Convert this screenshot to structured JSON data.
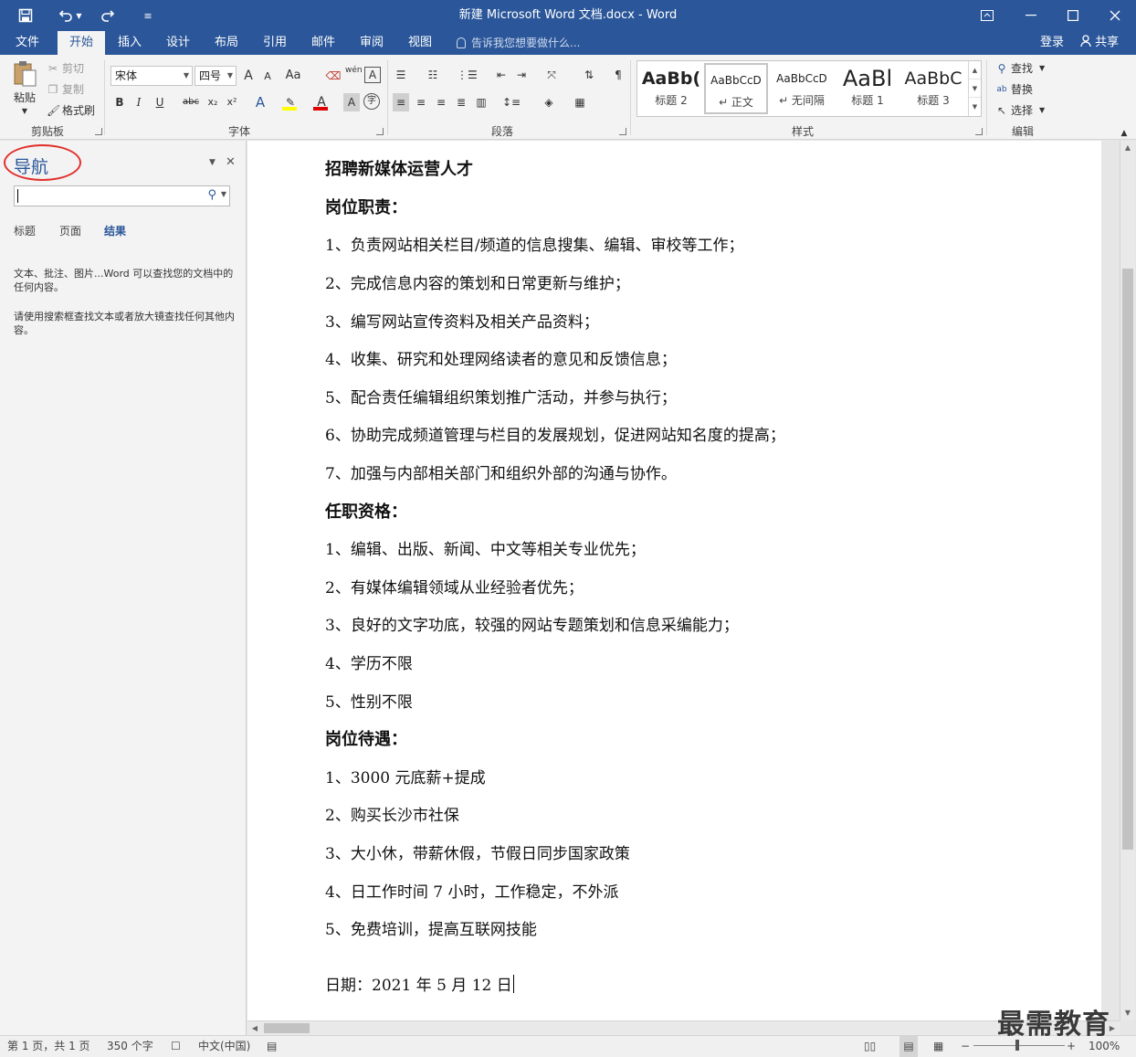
{
  "window": {
    "title": "新建 Microsoft Word 文档.docx - Word",
    "qa_customize_glyph": "≡"
  },
  "tabs": [
    {
      "label": "文件"
    },
    {
      "label": "开始"
    },
    {
      "label": "插入"
    },
    {
      "label": "设计"
    },
    {
      "label": "布局"
    },
    {
      "label": "引用"
    },
    {
      "label": "邮件"
    },
    {
      "label": "审阅"
    },
    {
      "label": "视图"
    }
  ],
  "tell_me": "告诉我您想要做什么...",
  "account": {
    "login": "登录",
    "share": "共享"
  },
  "ribbon": {
    "clipboard": {
      "label": "剪贴板",
      "paste": "粘贴",
      "cut": "剪切",
      "copy": "复制",
      "format_painter": "格式刷"
    },
    "font": {
      "label": "字体",
      "font_name": "宋体",
      "font_size": "四号",
      "grow": "A",
      "shrink": "A",
      "change_case": "Aa",
      "bold": "B",
      "italic": "I",
      "underline": "U",
      "strike": "abc",
      "subscript": "x₂",
      "superscript": "x²",
      "effects": "A",
      "font_color": "A",
      "char_shading": "A",
      "enclose": "字",
      "phonetic": "wén",
      "border_char": "A"
    },
    "paragraph": {
      "label": "段落"
    },
    "styles": {
      "label": "样式",
      "items": [
        {
          "sample": "AaBb(",
          "name": "标题 2"
        },
        {
          "sample": "AaBbCcD",
          "name": "↵ 正文"
        },
        {
          "sample": "AaBbCcD",
          "name": "↵ 无间隔"
        },
        {
          "sample": "AaBl",
          "name": "标题 1"
        },
        {
          "sample": "AaBbC",
          "name": "标题 3"
        }
      ]
    },
    "editing": {
      "label": "编辑",
      "find": "查找",
      "replace": "替换",
      "select": "选择"
    }
  },
  "nav": {
    "title": "导航",
    "search_value": "",
    "tabs": [
      "标题",
      "页面",
      "结果"
    ],
    "msg1": "文本、批注、图片...Word 可以查找您的文档中的任何内容。",
    "msg2": "请使用搜索框查找文本或者放大镜查找任何其他内容。"
  },
  "document": {
    "paragraphs": [
      {
        "text": "招聘新媒体运营人才",
        "heading": true
      },
      {
        "text": "岗位职责：",
        "heading": true
      },
      {
        "text": "1、负责网站相关栏目/频道的信息搜集、编辑、审校等工作；",
        "heading": false
      },
      {
        "text": "2、完成信息内容的策划和日常更新与维护；",
        "heading": false
      },
      {
        "text": "3、编写网站宣传资料及相关产品资料；",
        "heading": false
      },
      {
        "text": "4、收集、研究和处理网络读者的意见和反馈信息；",
        "heading": false
      },
      {
        "text": "5、配合责任编辑组织策划推广活动，并参与执行；",
        "heading": false
      },
      {
        "text": "6、协助完成频道管理与栏目的发展规划，促进网站知名度的提高；",
        "heading": false
      },
      {
        "text": "7、加强与内部相关部门和组织外部的沟通与协作。",
        "heading": false
      },
      {
        "text": "任职资格：",
        "heading": true
      },
      {
        "text": "1、编辑、出版、新闻、中文等相关专业优先；",
        "heading": false
      },
      {
        "text": "2、有媒体编辑领域从业经验者优先；",
        "heading": false
      },
      {
        "text": "3、良好的文字功底，较强的网站专题策划和信息采编能力；",
        "heading": false
      },
      {
        "text": "4、学历不限",
        "heading": false
      },
      {
        "text": "5、性别不限",
        "heading": false
      },
      {
        "text": "岗位待遇：",
        "heading": true
      },
      {
        "text": "1、3000 元底薪+提成",
        "heading": false
      },
      {
        "text": "2、购买长沙市社保",
        "heading": false
      },
      {
        "text": "3、大小休，带薪休假，节假日同步国家政策",
        "heading": false
      },
      {
        "text": "4、日工作时间 7 小时，工作稳定，不外派",
        "heading": false
      },
      {
        "text": "5、免费培训，提高互联网技能",
        "heading": false
      },
      {
        "text": "日期：2021 年 5 月 12 日",
        "heading": false
      }
    ]
  },
  "status": {
    "page": "第 1 页，共 1 页",
    "words": "350 个字",
    "language": "中文(中国)",
    "zoom": "100%"
  },
  "watermark": "最需教育",
  "colors": {
    "accent": "#2b579a",
    "highlight_circle": "#e0312c"
  }
}
